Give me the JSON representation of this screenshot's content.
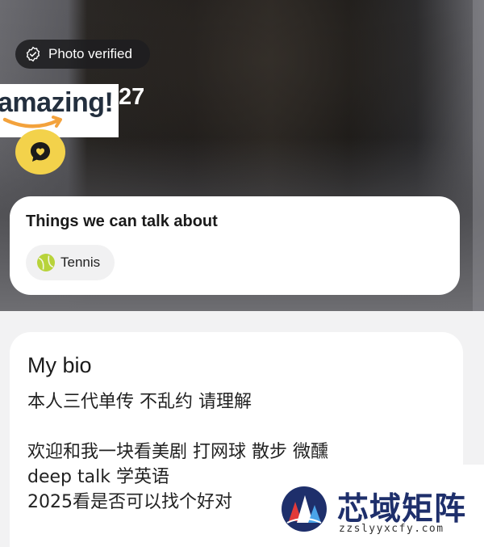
{
  "profile": {
    "verified_label": "Photo verified",
    "age": "27"
  },
  "overlay_ad": {
    "text": "amazing!"
  },
  "talk_about": {
    "title": "Things we can talk about",
    "chips": [
      {
        "label": "Tennis",
        "icon": "tennis-ball-icon"
      }
    ]
  },
  "bio": {
    "title": "My bio",
    "lines": [
      "本人三代单传 不乱约 请理解",
      "",
      "欢迎和我一块看美剧 打网球 散步 微醺",
      "deep talk 学英语",
      "2025看是否可以找个好对"
    ]
  },
  "watermark": {
    "name": "芯域矩阵",
    "url": "zzslyyxcfy.com"
  },
  "colors": {
    "like_button": "#f3d24b",
    "card_bg": "#ffffff",
    "page_bg": "#f2f2f3",
    "watermark_blue": "#1e2f6b"
  }
}
